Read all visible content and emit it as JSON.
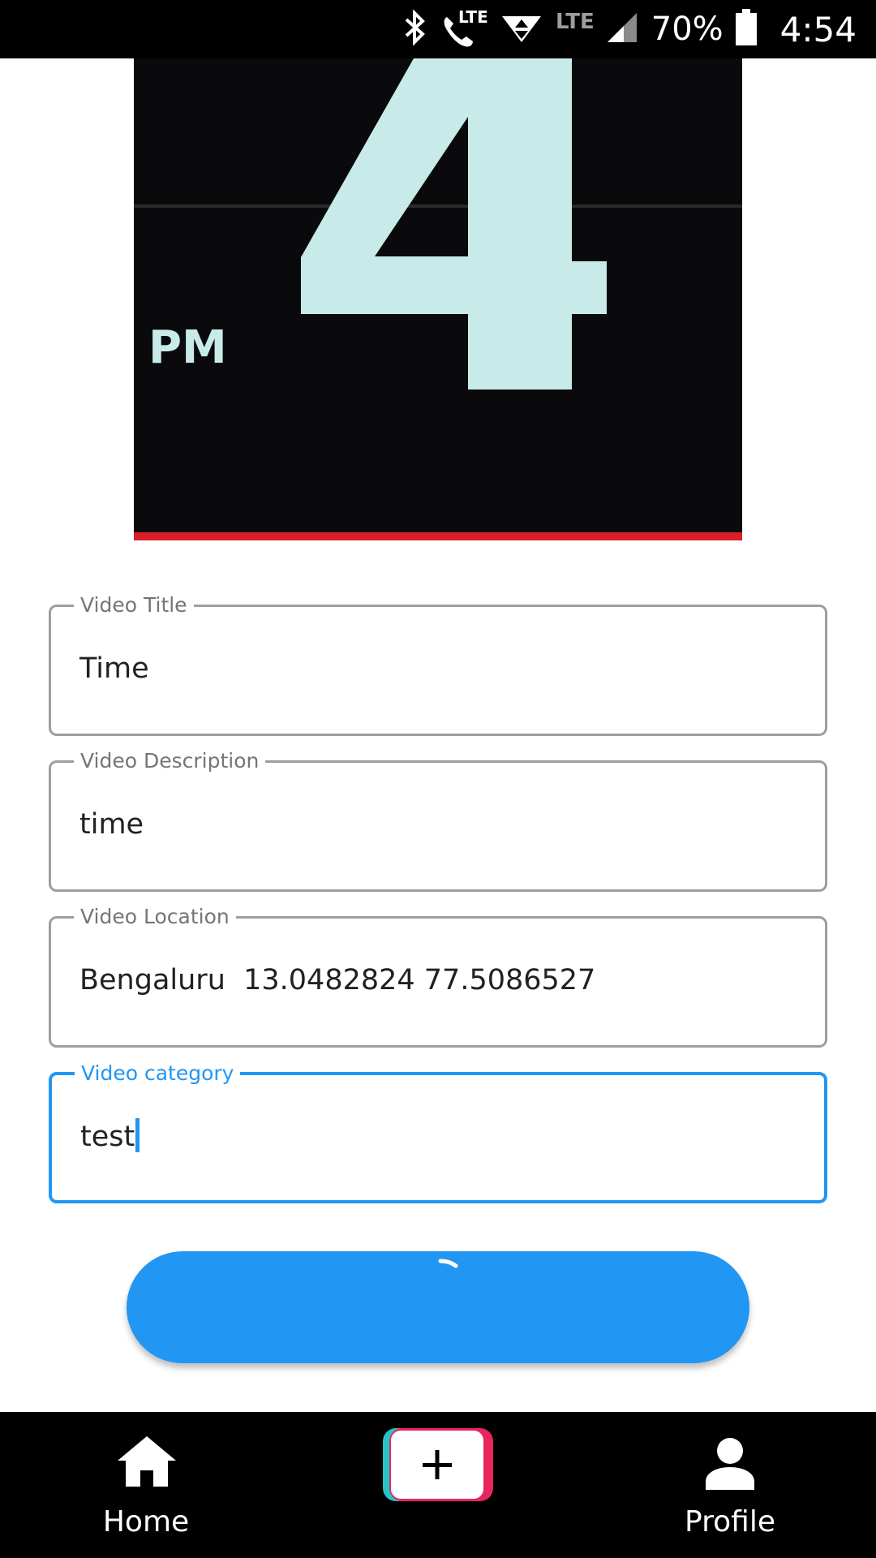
{
  "status_bar": {
    "network_label": "LTE",
    "network_label_2": "LTE",
    "battery": "70%",
    "time": "4:54"
  },
  "video_preview": {
    "overlay_period": "PM",
    "overlay_digit": "4",
    "progress_color": "#d91f2b"
  },
  "form": {
    "title": {
      "label": "Video Title",
      "value": "Time"
    },
    "description": {
      "label": "Video Description",
      "value": "time"
    },
    "location": {
      "label": "Video Location",
      "value": "Bengaluru  13.0482824 77.5086527"
    },
    "category": {
      "label": "Video category",
      "value": "test"
    }
  },
  "submit": {
    "state": "loading",
    "color": "#2196f3"
  },
  "bottom_nav": {
    "home_label": "Home",
    "add_icon": "plus-icon",
    "profile_label": "Profile"
  },
  "colors": {
    "accent": "#2196f3",
    "add_left": "#25c4c9",
    "add_right": "#e8255d"
  }
}
